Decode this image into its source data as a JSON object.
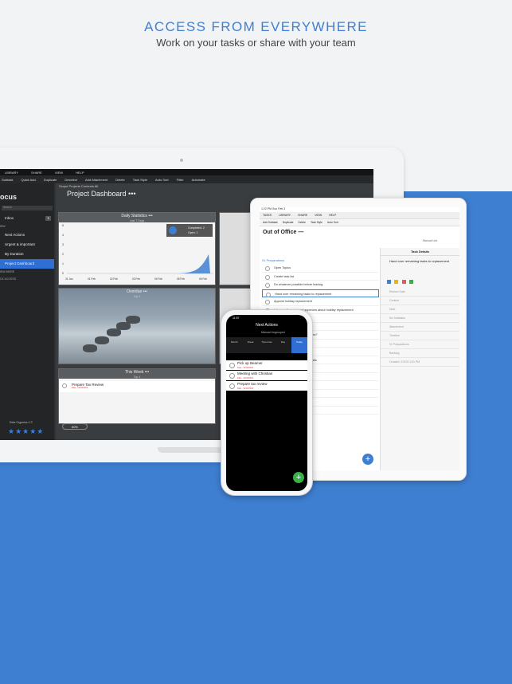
{
  "marketing": {
    "headline": "ACCESS FROM EVERYWHERE",
    "subheadline": "Work on your tasks or share with your team"
  },
  "colors": {
    "accent": "#3f7fd1",
    "dark_ui": "#2f3134",
    "fab_green": "#3aae4a"
  },
  "laptop": {
    "menu": [
      "LIBRARY",
      "SHARE",
      "VIEW",
      "HELP"
    ],
    "toolbar": [
      "Subtask",
      "Quick Add",
      "Duplicate",
      "Deselect",
      "Add Attachment",
      "Delete",
      "Task Style",
      "Auto Sort",
      "Filter",
      "Automate"
    ],
    "sidebar": {
      "title": "ocus",
      "search_placeholder": "Search",
      "inbox": "Inbox",
      "inbox_count": "1",
      "section_view": "IEW",
      "items": [
        "Next Actions",
        "Urgent & important",
        "By Duration",
        "Project Dashboard"
      ],
      "section_more": "IEW MORE",
      "section_quick": "CK ACCESS",
      "rate_text": "Rate Organize 4 ©",
      "stars": "★★★★★"
    },
    "main": {
      "crumbs": [
        "Scope",
        "Projects",
        "Contexts",
        "All"
      ],
      "title": "Project Dashboard •••",
      "card_stats_title": "Daily Statistics •••",
      "card_stats_sub": "Last 7 Days",
      "stats_legend_completed": "Completed: 2",
      "stats_legend_open": "Open: 1",
      "y_ticks": [
        "5",
        "4",
        "3",
        "2",
        "1",
        "0"
      ],
      "x_ticks": [
        "31 Jan",
        "01 Feb",
        "02 Feb",
        "03 Feb",
        "04 Feb",
        "05 Feb",
        "06 Feb"
      ],
      "card_overdue_title": "Overdue •••",
      "card_overdue_sub": "Top 4",
      "card_week_title": "This Week •••",
      "card_week_sub": "Top 4",
      "week_task": "Prepare Tax Review",
      "week_task_due": "Date · 22/03/2019",
      "zoom": "60%"
    }
  },
  "tablet": {
    "status": "1:22 PM  Sun Feb 3",
    "menu": [
      "TASKS",
      "LIBRARY",
      "SHARE",
      "VIEW",
      "HELP"
    ],
    "toolbar": [
      "Add Subtask",
      "Duplicate",
      "Delete",
      "Task Style",
      "Auto Sort"
    ],
    "title": "Out of Office —",
    "view_opts": [
      "Manual",
      "List"
    ],
    "group": "01 Preparations",
    "rows": [
      "Open Topics",
      "Create task list",
      "Do whatever possible before leaving",
      "Hand over remaining tasks to replacement",
      "Appoint holiday replacement",
      "Inform colleagues and superiors about holiday replacement"
    ],
    "more_rows": [
      "ed tasks",
      "emergencies",
      "t for which kind of emergencies?",
      "olved",
      "with contact details",
      "to your emails or forward emails",
      "ut absence",
      "portant",
      "ng",
      "ue",
      "task completion",
      "ut during absence"
    ],
    "detail": {
      "header": "Task Details",
      "task": "Hand over remaining tasks to replacement",
      "fields": [
        "Review Date",
        "Context",
        "Note",
        "No Subtasks",
        "Attachment",
        "Timeline",
        "01 Preparations",
        "Backlog",
        "Created: 2/3/19 1:51 PM"
      ]
    }
  },
  "phone": {
    "time": "11:57",
    "title": "Next Actions",
    "filters": [
      "Manual",
      "Ungrouped"
    ],
    "tabs": [
      "Month",
      "Week",
      "Tomorrow",
      "Day",
      "Today"
    ],
    "tasks": [
      {
        "name": "Pick up Beamer",
        "due": "Date · 22/03/2019"
      },
      {
        "name": "Meeting with Christian",
        "due": "Date · 22/03/2019"
      },
      {
        "name": "Prepare tax review",
        "due": "Date · 22/03/2019"
      }
    ]
  }
}
